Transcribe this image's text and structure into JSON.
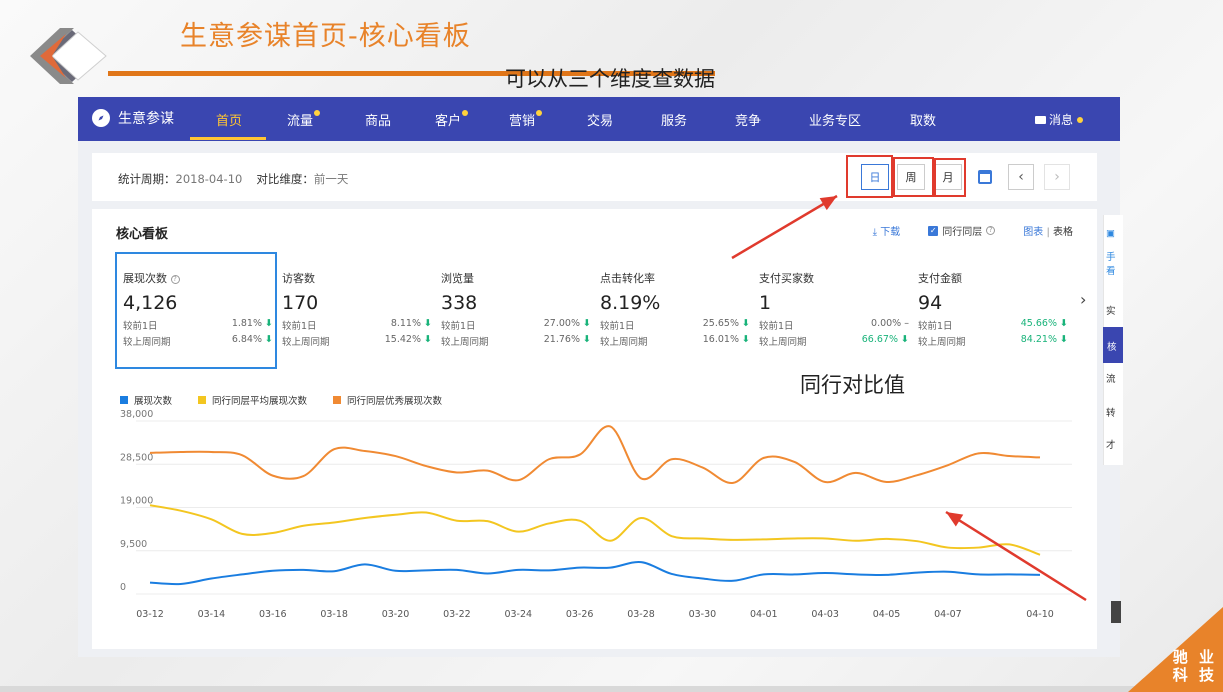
{
  "slide": {
    "title": "生意参谋首页-核心看板",
    "annotation_dimensions": "可以从三个维度查数据",
    "annotation_compare": "同行对比值",
    "corner_badge": [
      "驰 业",
      "科 技"
    ],
    "accent_color": "#e8832a"
  },
  "nav": {
    "brand": "生意参谋",
    "items": [
      {
        "label": "首页",
        "active": true,
        "dot": false
      },
      {
        "label": "流量",
        "active": false,
        "dot": true
      },
      {
        "label": "商品",
        "active": false,
        "dot": false
      },
      {
        "label": "客户",
        "active": false,
        "dot": true
      },
      {
        "label": "营销",
        "active": false,
        "dot": true
      },
      {
        "label": "交易",
        "active": false,
        "dot": false
      },
      {
        "label": "服务",
        "active": false,
        "dot": false
      },
      {
        "label": "竞争",
        "active": false,
        "dot": false
      },
      {
        "label": "业务专区",
        "active": false,
        "dot": false
      },
      {
        "label": "取数",
        "active": false,
        "dot": false
      }
    ],
    "message": "消息",
    "color": "#3a46b0"
  },
  "period": {
    "label": "统计周期：",
    "date": "2018-04-10",
    "compare_label": "对比维度：",
    "compare_value": "前一天",
    "buttons": [
      "日",
      "周",
      "月"
    ],
    "selected": "日",
    "prev": "‹",
    "next": "›"
  },
  "board": {
    "title": "核心看板",
    "download": "下载",
    "peer_label": "同行同层",
    "chart_label": "图表",
    "separator": "|",
    "table_label": "表格",
    "metrics": [
      {
        "name": "展现次数",
        "help": "?",
        "value": "4,126",
        "row1_label": "较前1日",
        "row1_value": "1.81%",
        "row1_trend": "⬇",
        "row2_label": "较上周同期",
        "row2_value": "6.84%",
        "row2_trend": "⬇"
      },
      {
        "name": "访客数",
        "value": "170",
        "row1_label": "较前1日",
        "row1_value": "8.11%",
        "row1_trend": "⬇",
        "row2_label": "较上周同期",
        "row2_value": "15.42%",
        "row2_trend": "⬇"
      },
      {
        "name": "浏览量",
        "value": "338",
        "row1_label": "较前1日",
        "row1_value": "27.00%",
        "row1_trend": "⬇",
        "row2_label": "较上周同期",
        "row2_value": "21.76%",
        "row2_trend": "⬇"
      },
      {
        "name": "点击转化率",
        "value": "8.19%",
        "row1_label": "较前1日",
        "row1_value": "25.65%",
        "row1_trend": "⬇",
        "row2_label": "较上周同期",
        "row2_value": "16.01%",
        "row2_trend": "⬇"
      },
      {
        "name": "支付买家数",
        "value": "1",
        "row1_label": "较前1日",
        "row1_value": "0.00%",
        "row1_trend": "–",
        "row2_label": "较上周同期",
        "row2_value": "66.67%",
        "row2_trend": "⬇"
      },
      {
        "name": "支付金额",
        "value": "94",
        "row1_label": "较前1日",
        "row1_value": "45.66%",
        "row1_trend": "⬇",
        "row2_label": "较上周同期",
        "row2_value": "84.21%",
        "row2_trend": "⬇"
      }
    ],
    "more": "›",
    "up_color": "#19b37a"
  },
  "side_items": [
    "手",
    "看",
    "实",
    "核",
    "流",
    "转",
    "才"
  ],
  "chart_data": {
    "type": "line",
    "x": [
      "03-12",
      "03-13",
      "03-14",
      "03-15",
      "03-16",
      "03-17",
      "03-18",
      "03-19",
      "03-20",
      "03-21",
      "03-22",
      "03-23",
      "03-24",
      "03-25",
      "03-26",
      "03-27",
      "03-28",
      "03-29",
      "03-30",
      "03-31",
      "04-01",
      "04-02",
      "04-03",
      "04-04",
      "04-05",
      "04-06",
      "04-07",
      "04-08",
      "04-09",
      "04-10"
    ],
    "xticks": [
      "03-12",
      "03-14",
      "03-16",
      "03-18",
      "03-20",
      "03-22",
      "03-24",
      "03-26",
      "03-28",
      "03-30",
      "04-01",
      "04-03",
      "04-05",
      "04-07",
      "04-10"
    ],
    "yticks": [
      0,
      9500,
      19000,
      28500,
      38000
    ],
    "ytick_labels": [
      "0",
      "9,500",
      "19,000",
      "28,500",
      "38,000"
    ],
    "ylim": [
      0,
      38000
    ],
    "series": [
      {
        "name": "展现次数",
        "color": "#1a7de0",
        "values": [
          2500,
          2200,
          3400,
          4300,
          5100,
          5300,
          5000,
          6500,
          5100,
          5200,
          5300,
          4500,
          5300,
          5200,
          5800,
          5800,
          7000,
          4400,
          3400,
          2900,
          4300,
          4300,
          4600,
          4300,
          4200,
          4700,
          4900,
          4300,
          4300,
          4200
        ]
      },
      {
        "name": "同行同层平均展现次数",
        "color": "#f3c620",
        "values": [
          19500,
          18300,
          16400,
          13200,
          13400,
          15000,
          15700,
          16700,
          17400,
          17900,
          16100,
          16000,
          13700,
          15500,
          16100,
          11700,
          16700,
          12700,
          12200,
          11900,
          12000,
          12200,
          12200,
          11700,
          12100,
          11600,
          10200,
          10200,
          10900,
          8600
        ]
      },
      {
        "name": "同行同层优秀展现次数",
        "color": "#f08a33",
        "values": [
          31000,
          31200,
          31200,
          30500,
          26000,
          25900,
          31800,
          31400,
          30300,
          28100,
          26700,
          27100,
          25000,
          29600,
          30600,
          36800,
          25400,
          29600,
          27800,
          24400,
          29900,
          29000,
          24600,
          26600,
          24600,
          26100,
          28300,
          30900,
          30300,
          30000
        ]
      }
    ]
  }
}
